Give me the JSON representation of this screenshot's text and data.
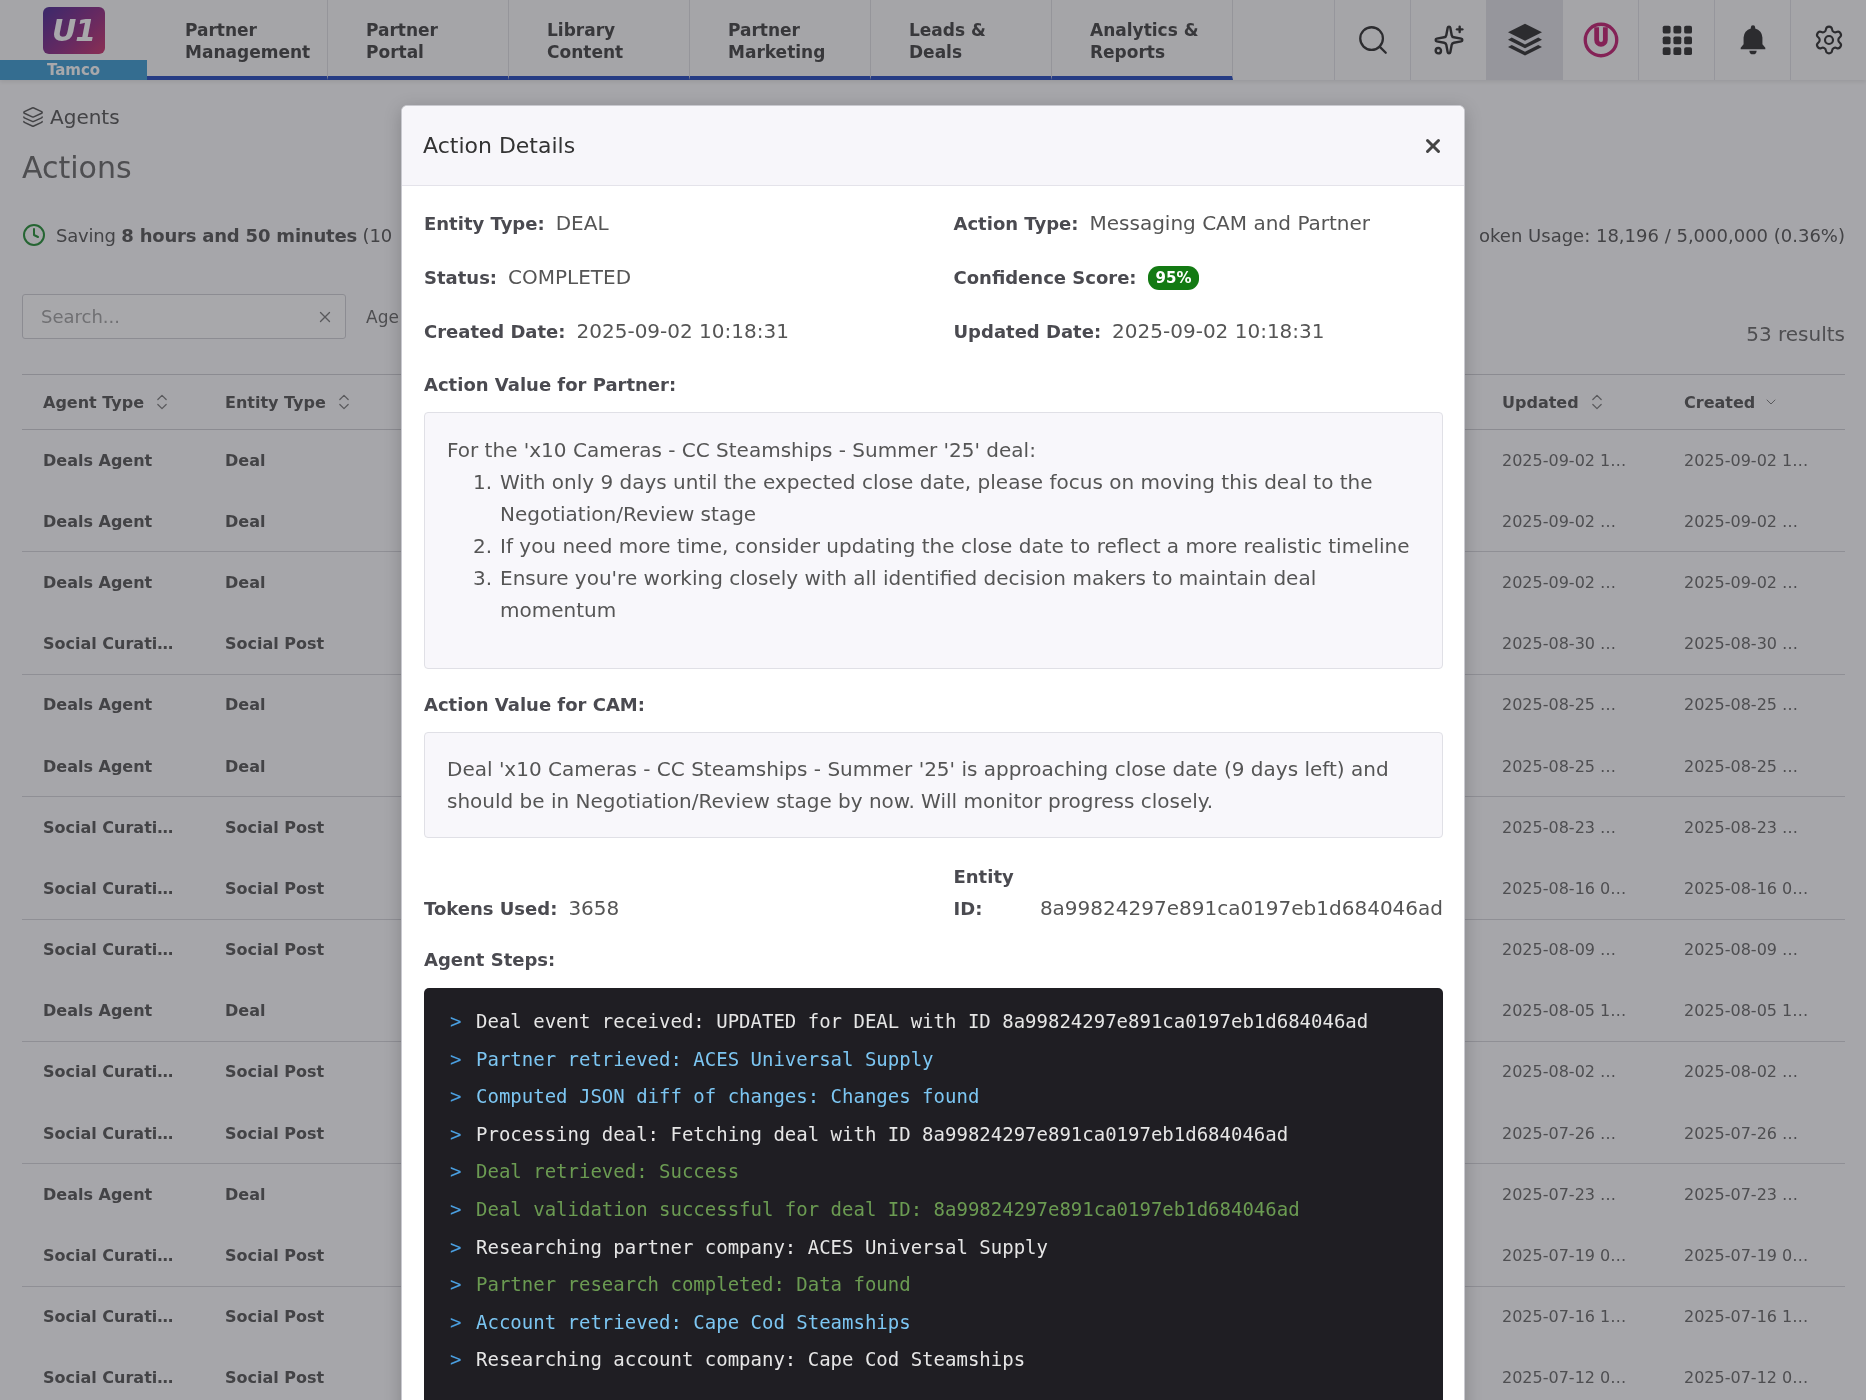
{
  "nav": {
    "logo": {
      "mark": "U1",
      "org": "Tamco"
    },
    "tabs": [
      {
        "label": "Partner Management"
      },
      {
        "label": "Partner Portal"
      },
      {
        "label": "Library Content"
      },
      {
        "label": "Partner Marketing"
      },
      {
        "label": "Leads & Deals"
      },
      {
        "label": "Analytics & Reports"
      }
    ],
    "tools": [
      {
        "kind": "search",
        "selected": false
      },
      {
        "kind": "sparkles",
        "selected": false
      },
      {
        "kind": "layers",
        "selected": true
      },
      {
        "kind": "brand",
        "selected": false
      },
      {
        "kind": "apps",
        "selected": false
      },
      {
        "kind": "notifications",
        "selected": false
      },
      {
        "kind": "settings",
        "selected": false
      }
    ]
  },
  "page": {
    "breadcrumb": "Agents",
    "title": "Actions",
    "savings": "Saving **8 hours and 50 minutes** (10",
    "token_usage": "oken Usage: 18,196 / 5,000,000 (0.36%)",
    "search": {
      "placeholder": "Search..."
    },
    "filter_label": "Age",
    "results": "53 results"
  },
  "table": {
    "columns": [
      {
        "label": "Agent Type",
        "sorted": false
      },
      {
        "label": "Entity Type",
        "sorted": false
      },
      {
        "label": "Updated",
        "sorted": false
      },
      {
        "label": "Created",
        "sorted": true
      }
    ],
    "rows": [
      [
        "Deals Agent",
        "Deal",
        "2025-09-02 1…",
        "2025-09-02 1…"
      ],
      [
        "Deals Agent",
        "Deal",
        "2025-09-02 …",
        "2025-09-02 …"
      ],
      [
        "Deals Agent",
        "Deal",
        "2025-09-02 …",
        "2025-09-02 …"
      ],
      [
        "Social Curati…",
        "Social Post",
        "2025-08-30 …",
        "2025-08-30 …"
      ],
      [
        "Deals Agent",
        "Deal",
        "2025-08-25 …",
        "2025-08-25 …"
      ],
      [
        "Deals Agent",
        "Deal",
        "2025-08-25 …",
        "2025-08-25 …"
      ],
      [
        "Social Curati…",
        "Social Post",
        "2025-08-23 …",
        "2025-08-23 …"
      ],
      [
        "Social Curati…",
        "Social Post",
        "2025-08-16 0…",
        "2025-08-16 0…"
      ],
      [
        "Social Curati…",
        "Social Post",
        "2025-08-09 …",
        "2025-08-09 …"
      ],
      [
        "Deals Agent",
        "Deal",
        "2025-08-05 1…",
        "2025-08-05 1…"
      ],
      [
        "Social Curati…",
        "Social Post",
        "2025-08-02 …",
        "2025-08-02 …"
      ],
      [
        "Social Curati…",
        "Social Post",
        "2025-07-26 …",
        "2025-07-26 …"
      ],
      [
        "Deals Agent",
        "Deal",
        "2025-07-23 …",
        "2025-07-23 …"
      ],
      [
        "Social Curati…",
        "Social Post",
        "2025-07-19 0…",
        "2025-07-19 0…"
      ],
      [
        "Social Curati…",
        "Social Post",
        "2025-07-16 1…",
        "2025-07-16 1…"
      ],
      [
        "Social Curati…",
        "Social Post",
        "2025-07-12 0…",
        "2025-07-12 0…"
      ]
    ]
  },
  "modal": {
    "title": "Action Details",
    "fields": [
      {
        "label": "Entity Type:",
        "value": "DEAL",
        "kind": "text"
      },
      {
        "label": "Action Type:",
        "value": "Messaging CAM and Partner",
        "kind": "text"
      },
      {
        "label": "Status:",
        "value": "COMPLETED",
        "kind": "text"
      },
      {
        "label": "Confidence Score:",
        "value": "95%",
        "kind": "badge"
      },
      {
        "label": "Created Date:",
        "value": "2025-09-02 10:18:31",
        "kind": "text"
      },
      {
        "label": "Updated Date:",
        "value": "2025-09-02 10:18:31",
        "kind": "text"
      }
    ],
    "partner_value": {
      "label": "Action Value for Partner:",
      "intro": "For the 'x10 Cameras - CC Steamships - Summer '25' deal:",
      "items": [
        {
          "number": "1.",
          "text": "With only 9 days until the expected close date, please focus on moving this deal to the Negotiation/Review stage"
        },
        {
          "number": "2.",
          "text": "If you need more time, consider updating the close date to reflect a more realistic timeline"
        },
        {
          "number": "3.",
          "text": "Ensure you're working closely with all identified decision makers to maintain deal momentum"
        }
      ]
    },
    "cam_value": {
      "label": "Action Value for CAM:",
      "text": "Deal 'x10 Cameras - CC Steamships - Summer '25' is approaching close date (9 days left) and should be in Negotiation/Review stage by now. Will monitor progress closely."
    },
    "meta": [
      {
        "label": "Tokens Used:",
        "value": "3658",
        "kind": "text"
      },
      {
        "label": "Entity ID:",
        "value": "8a99824297e891ca0197eb1d684046ad",
        "kind": "text"
      }
    ],
    "steps": {
      "label": "Agent Steps:",
      "lines": [
        {
          "prompt": ">",
          "text": "Deal event received: UPDATED for DEAL with ID 8a99824297e891ca0197eb1d684046ad",
          "color": "#e6e6e6"
        },
        {
          "prompt": ">",
          "text": "Partner retrieved: ACES Universal Supply",
          "color": "#7cc6f2"
        },
        {
          "prompt": ">",
          "text": "Computed JSON diff of changes: Changes found",
          "color": "#7cc6f2"
        },
        {
          "prompt": ">",
          "text": "Processing deal: Fetching deal with ID 8a99824297e891ca0197eb1d684046ad",
          "color": "#e6e6e6"
        },
        {
          "prompt": ">",
          "text": "Deal retrieved: Success",
          "color": "#6b9b52"
        },
        {
          "prompt": ">",
          "text": "Deal validation successful for deal ID: 8a99824297e891ca0197eb1d684046ad",
          "color": "#6b9b52"
        },
        {
          "prompt": ">",
          "text": "Researching partner company: ACES Universal Supply",
          "color": "#e6e6e6"
        },
        {
          "prompt": ">",
          "text": "Partner research completed: Data found",
          "color": "#6b9b52"
        },
        {
          "prompt": ">",
          "text": "Account retrieved: Cape Cod Steamships",
          "color": "#7cc6f2"
        },
        {
          "prompt": ">",
          "text": "Researching account company: Cape Cod Steamships",
          "color": "#e6e6e6"
        }
      ]
    }
  }
}
